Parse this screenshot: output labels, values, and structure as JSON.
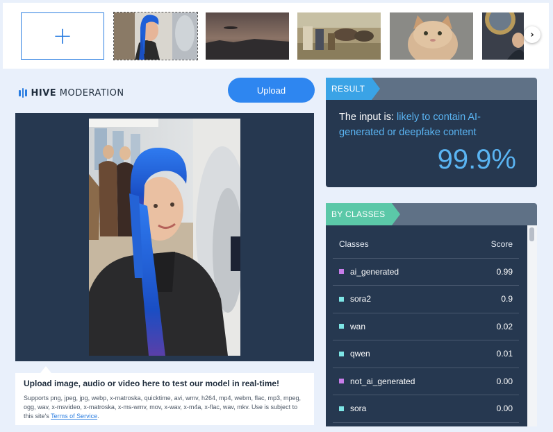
{
  "thumbnails": [
    {
      "name": "thumb-blue-hair-woman",
      "selected": true
    },
    {
      "name": "thumb-dusk-landscape",
      "selected": false
    },
    {
      "name": "thumb-painting-camels",
      "selected": false
    },
    {
      "name": "thumb-cat",
      "selected": false
    },
    {
      "name": "thumb-person-in-room",
      "selected": false
    }
  ],
  "add_label": "+",
  "next_label": "›",
  "brand": {
    "bold": "HIVE",
    "rest": " MODERATION"
  },
  "upload_label": "Upload",
  "caption": {
    "title": "Upload image, audio or video here to test our model in real-time!",
    "text": "Supports png, jpeg, jpg, webp, x-matroska, quicktime, avi, wmv, h264, mp4, webm, flac, mp3, mpeg, ogg, wav, x-msvideo, x-matroska, x-ms-wmv, mov, x-wav, x-m4a, x-flac, wav, mkv. Use is subject to this site's ",
    "link": "Terms of Service",
    "end": "."
  },
  "result": {
    "tag": "RESULT",
    "prefix": "The input is: ",
    "verdict": "likely to contain AI-generated or deepfake content",
    "score": "99.9%"
  },
  "classes": {
    "tag": "BY CLASSES",
    "header_class": "Classes",
    "header_score": "Score",
    "rows": [
      {
        "name": "ai_generated",
        "score": "0.99",
        "color": "#c77dea"
      },
      {
        "name": "sora2",
        "score": "0.9",
        "color": "#7ee6e6"
      },
      {
        "name": "wan",
        "score": "0.02",
        "color": "#7ee6e6"
      },
      {
        "name": "qwen",
        "score": "0.01",
        "color": "#7ee6e6"
      },
      {
        "name": "not_ai_generated",
        "score": "0.00",
        "color": "#c77dea"
      },
      {
        "name": "sora",
        "score": "0.00",
        "color": "#7ee6e6"
      }
    ]
  }
}
